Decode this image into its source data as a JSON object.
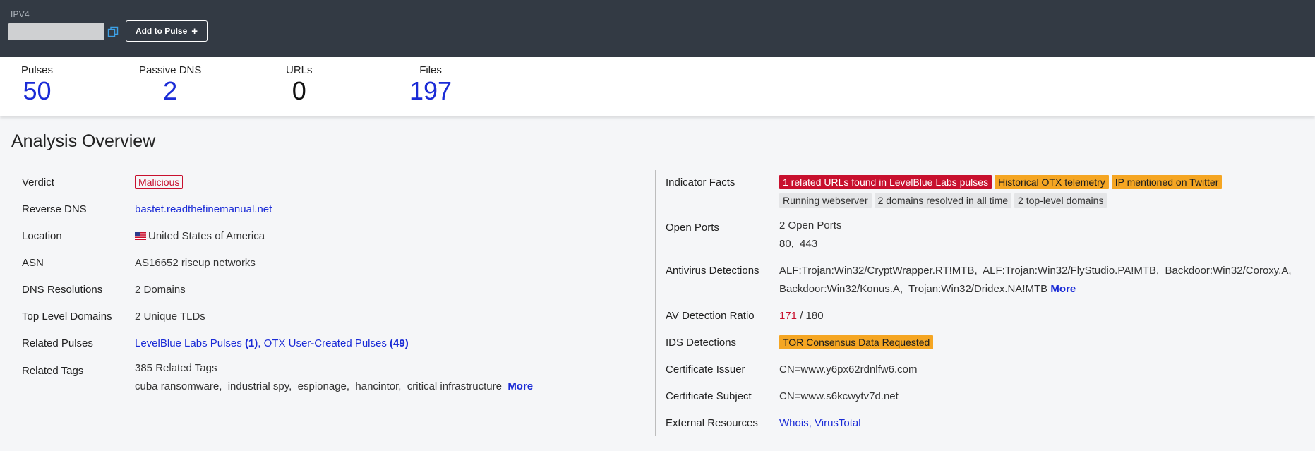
{
  "header": {
    "ip_type": "IPV4",
    "add_to_pulse_label": "Add to Pulse",
    "add_icon": "plus-icon",
    "copy_icon": "copy-icon"
  },
  "stats": [
    {
      "label": "Pulses",
      "value": "50"
    },
    {
      "label": "Passive DNS",
      "value": "2"
    },
    {
      "label": "URLs",
      "value": "0"
    },
    {
      "label": "Files",
      "value": "197"
    }
  ],
  "overview": {
    "title": "Analysis Overview",
    "verdict": {
      "label": "Verdict",
      "value": "Malicious"
    },
    "reverse_dns": {
      "label": "Reverse DNS",
      "value": "bastet.readthefinemanual.net"
    },
    "location": {
      "label": "Location",
      "value": "United States of America"
    },
    "asn": {
      "label": "ASN",
      "value": "AS16652 riseup networks"
    },
    "dns_resolutions": {
      "label": "DNS Resolutions",
      "value": "2 Domains"
    },
    "tlds": {
      "label": "Top Level Domains",
      "value": "2 Unique TLDs"
    },
    "related_pulses": {
      "label": "Related Pulses",
      "lb_name": "LevelBlue Labs Pulses",
      "lb_count": "(1)",
      "separator": ",",
      "otx_name": "OTX User-Created Pulses",
      "otx_count": "(49)"
    },
    "related_tags": {
      "label": "Related Tags",
      "count": "385 Related Tags",
      "tags": "cuba ransomware,  industrial spy,  espionage,  hancintor,  critical infrastructure",
      "more": "More"
    }
  },
  "right": {
    "indicator_facts": {
      "label": "Indicator Facts",
      "facts": [
        "1 related URLs found in LevelBlue Labs pulses",
        "Historical OTX telemetry",
        "IP mentioned on Twitter",
        "Running webserver",
        "2 domains resolved in all time",
        "2 top-level domains"
      ]
    },
    "open_ports": {
      "label": "Open Ports",
      "summary": "2 Open Ports",
      "ports": "80,  443"
    },
    "antivirus": {
      "label": "Antivirus Detections",
      "line1": "ALF:Trojan:Win32/CryptWrapper.RT!MTB,  ALF:Trojan:Win32/FlyStudio.PA!MTB,  Backdoor:Win32/Coroxy.A,",
      "line2": "Backdoor:Win32/Konus.A,  Trojan:Win32/Dridex.NA!MTB",
      "more": "More"
    },
    "av_ratio": {
      "label": "AV Detection Ratio",
      "detected": "171",
      "total": " / 180"
    },
    "ids": {
      "label": "IDS Detections",
      "value": "TOR Consensus Data Requested"
    },
    "cert_issuer": {
      "label": "Certificate Issuer",
      "value": "CN=www.y6px62rdnlfw6.com"
    },
    "cert_subject": {
      "label": "Certificate Subject",
      "value": "CN=www.s6kcwytv7d.net"
    },
    "external": {
      "label": "External Resources",
      "value": "Whois, VirusTotal"
    }
  },
  "colors": {
    "header_bg": "#333a44",
    "accent_blue": "#1a2bd6",
    "malicious_red": "#c8102e",
    "warning_orange": "#f5a623"
  }
}
